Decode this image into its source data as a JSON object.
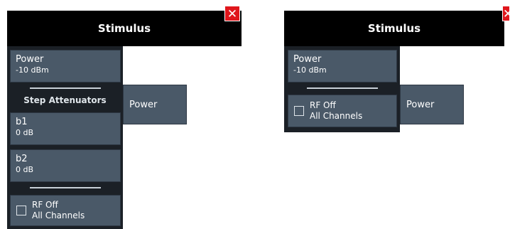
{
  "left_panel": {
    "title": "Stimulus",
    "close_glyph": "✕",
    "power": {
      "label": "Power",
      "value": "-10 dBm"
    },
    "section_label": "Step Attenuators",
    "b1": {
      "label": "b1",
      "value": "0 dB"
    },
    "b2": {
      "label": "b2",
      "value": "0 dB"
    },
    "rf_off": {
      "line1": "RF Off",
      "line2": "All Channels"
    },
    "side_tab": "Power"
  },
  "right_panel": {
    "title": "Stimulus",
    "close_glyph": "✕",
    "power": {
      "label": "Power",
      "value": "-10 dBm"
    },
    "rf_off": {
      "line1": "RF Off",
      "line2": "All Channels"
    },
    "side_tab": "Power"
  },
  "colors": {
    "header_bg": "#000000",
    "close_bg": "#e0161c",
    "button_bg": "#4a5968",
    "menu_bg": "#1b2026"
  }
}
